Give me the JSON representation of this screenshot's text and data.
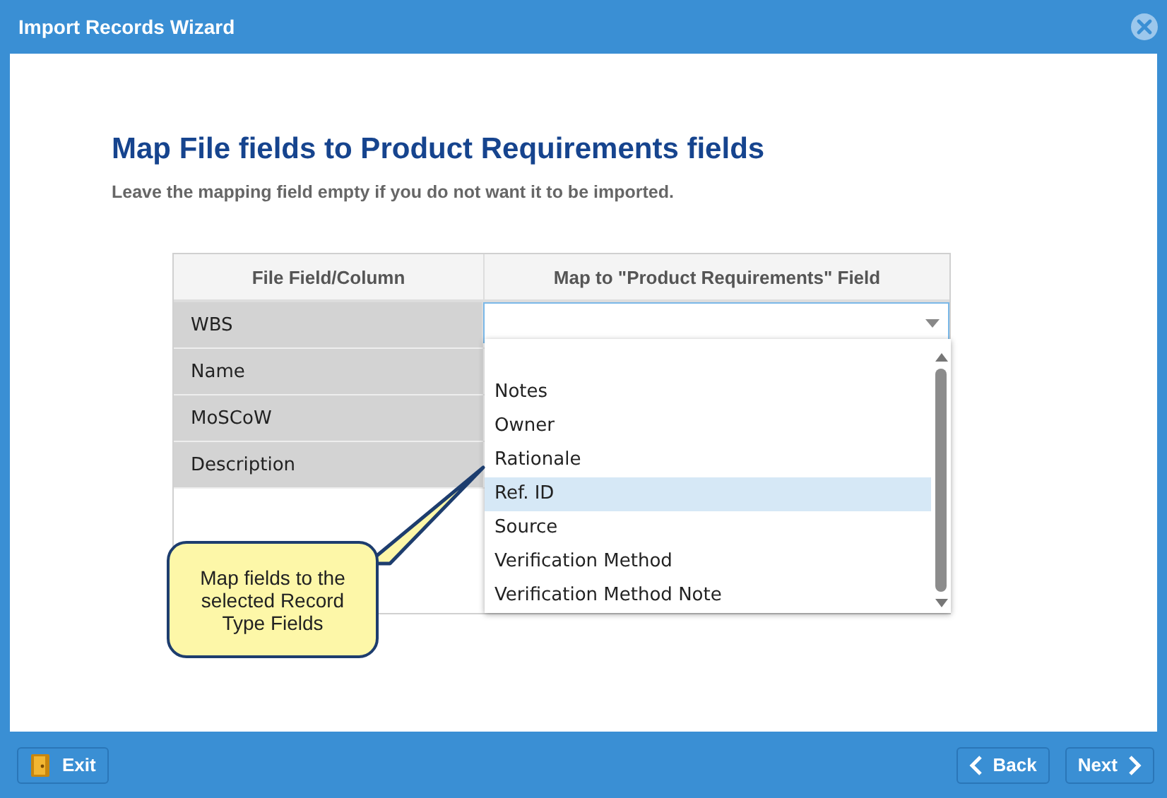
{
  "window": {
    "title": "Import Records Wizard"
  },
  "heading": "Map File fields to Product Requirements fields",
  "subheading": "Leave the mapping field empty if you do not want it to be imported.",
  "table": {
    "columns": [
      "File Field/Column",
      "Map to \"Product Requirements\" Field"
    ],
    "rows": [
      {
        "file_field": "WBS"
      },
      {
        "file_field": "Name"
      },
      {
        "file_field": "MoSCoW"
      },
      {
        "file_field": "Description"
      }
    ]
  },
  "dropdown": {
    "options": [
      {
        "label": "Notes",
        "selected": false
      },
      {
        "label": "Owner",
        "selected": false
      },
      {
        "label": "Rationale",
        "selected": false
      },
      {
        "label": "Ref. ID",
        "selected": true
      },
      {
        "label": "Source",
        "selected": false
      },
      {
        "label": "Verification Method",
        "selected": false
      },
      {
        "label": "Verification Method Note",
        "selected": false
      }
    ]
  },
  "callout": "Map fields to the selected Record Type Fields",
  "buttons": {
    "exit": "Exit",
    "back": "Back",
    "next": "Next"
  }
}
